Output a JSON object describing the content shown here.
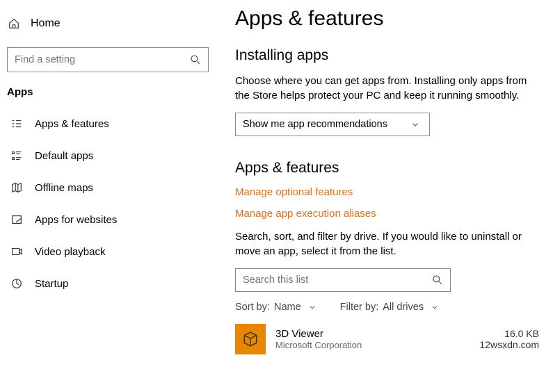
{
  "sidebar": {
    "home": "Home",
    "search_placeholder": "Find a setting",
    "section": "Apps",
    "items": [
      {
        "label": "Apps & features"
      },
      {
        "label": "Default apps"
      },
      {
        "label": "Offline maps"
      },
      {
        "label": "Apps for websites"
      },
      {
        "label": "Video playback"
      },
      {
        "label": "Startup"
      }
    ]
  },
  "main": {
    "title": "Apps & features",
    "install_heading": "Installing apps",
    "install_desc": "Choose where you can get apps from. Installing only apps from the Store helps protect your PC and keep it running smoothly.",
    "install_dropdown": "Show me app recommendations",
    "af_heading": "Apps & features",
    "link_optional": "Manage optional features",
    "link_aliases": "Manage app execution aliases",
    "af_desc": "Search, sort, and filter by drive. If you would like to uninstall or move an app, select it from the list.",
    "search2_placeholder": "Search this list",
    "sort_label": "Sort by:",
    "sort_value": "Name",
    "filter_label": "Filter by:",
    "filter_value": "All drives",
    "app": {
      "name": "3D Viewer",
      "publisher": "Microsoft Corporation",
      "size": "16.0 KB",
      "date": "12wsxdn.com"
    }
  }
}
